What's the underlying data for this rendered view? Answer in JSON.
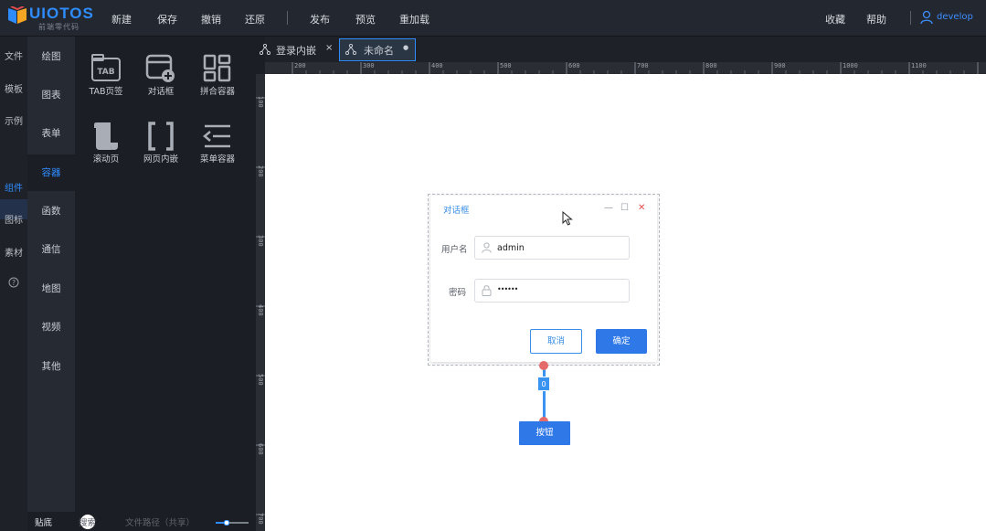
{
  "app": {
    "logo_text": "UIOTOS",
    "logo_sub": "前端零代码",
    "brand_color": "#2f8cff"
  },
  "toolbar": {
    "items": [
      "新建",
      "保存",
      "撤销",
      "还原",
      "发布",
      "预览",
      "重加载"
    ],
    "right": [
      "收藏",
      "帮助"
    ],
    "user": "develop"
  },
  "left_nav": {
    "items": [
      "文件",
      "模板",
      "示例",
      "组件",
      "图标",
      "素材"
    ],
    "active": "组件",
    "help_icon": "help-circle-icon"
  },
  "categories": {
    "items": [
      "绘图",
      "图表",
      "表单",
      "容器",
      "函数",
      "通信",
      "地图",
      "视频",
      "其他"
    ],
    "active": "容器"
  },
  "components": [
    {
      "label": "TAB页签",
      "icon": "tab-icon"
    },
    {
      "label": "对话框",
      "icon": "dialog-add-icon"
    },
    {
      "label": "拼合容器",
      "icon": "grid-container-icon"
    },
    {
      "label": "滚动页",
      "icon": "scroll-icon"
    },
    {
      "label": "网页内嵌",
      "icon": "brackets-icon"
    },
    {
      "label": "菜单容器",
      "icon": "menu-container-icon"
    }
  ],
  "tabs": [
    {
      "label": "登录内嵌",
      "close": "×"
    },
    {
      "label": "未命名",
      "close": "●"
    }
  ],
  "ruler": {
    "h_ticks": [
      "200",
      "300",
      "400",
      "500",
      "600",
      "700",
      "800",
      "900",
      "1000",
      "1100"
    ],
    "v_ticks": [
      "100",
      "200",
      "300",
      "400",
      "500",
      "600",
      "700"
    ]
  },
  "dialog": {
    "title": "对话框",
    "min": "—",
    "max": "☐",
    "close": "✕",
    "username_label": "用户名",
    "username_value": "admin",
    "password_label": "密码",
    "password_value": "••••••",
    "cancel": "取消",
    "ok": "确定"
  },
  "link": {
    "badge": "0"
  },
  "control_button": "按钮",
  "bottom_bar": {
    "toggle_label": "贴底",
    "search": "搜索",
    "path": "文件路径（共享）"
  }
}
